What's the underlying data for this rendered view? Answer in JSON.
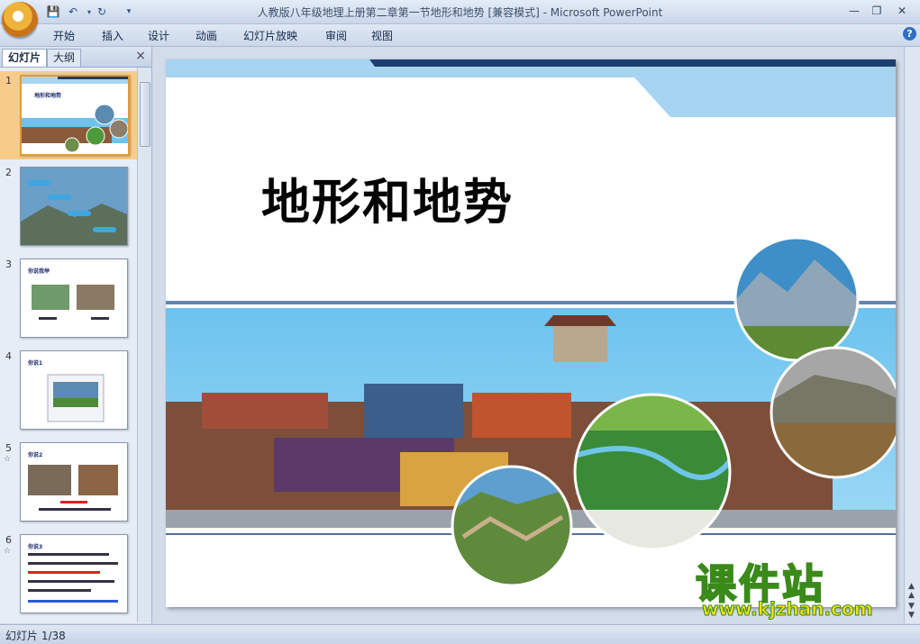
{
  "window": {
    "title": "人教版八年级地理上册第二章第一节地形和地势 [兼容模式] - Microsoft PowerPoint"
  },
  "ribbon": {
    "tabs": [
      "开始",
      "插入",
      "设计",
      "动画",
      "幻灯片放映",
      "审阅",
      "视图"
    ]
  },
  "panel": {
    "tabs": [
      "幻灯片",
      "大纲"
    ],
    "close_icon": "×",
    "slides": [
      {
        "number": "1",
        "title": "地形和地势",
        "selected": true
      },
      {
        "number": "2",
        "title": ""
      },
      {
        "number": "3",
        "title": "你说我举"
      },
      {
        "number": "4",
        "title": "你说1"
      },
      {
        "number": "5",
        "title": "你说2"
      },
      {
        "number": "6",
        "title": "你说3"
      }
    ]
  },
  "slide": {
    "title": "地形和地势"
  },
  "watermark": {
    "main": "课件站",
    "url": "www.kjzhan.com"
  },
  "status": {
    "text": "幻灯片 1/38"
  },
  "colors": {
    "accent_blue": "#1c3f6e",
    "sky": "#7fc6ef",
    "selected_thumb": "#f7cc8b"
  }
}
